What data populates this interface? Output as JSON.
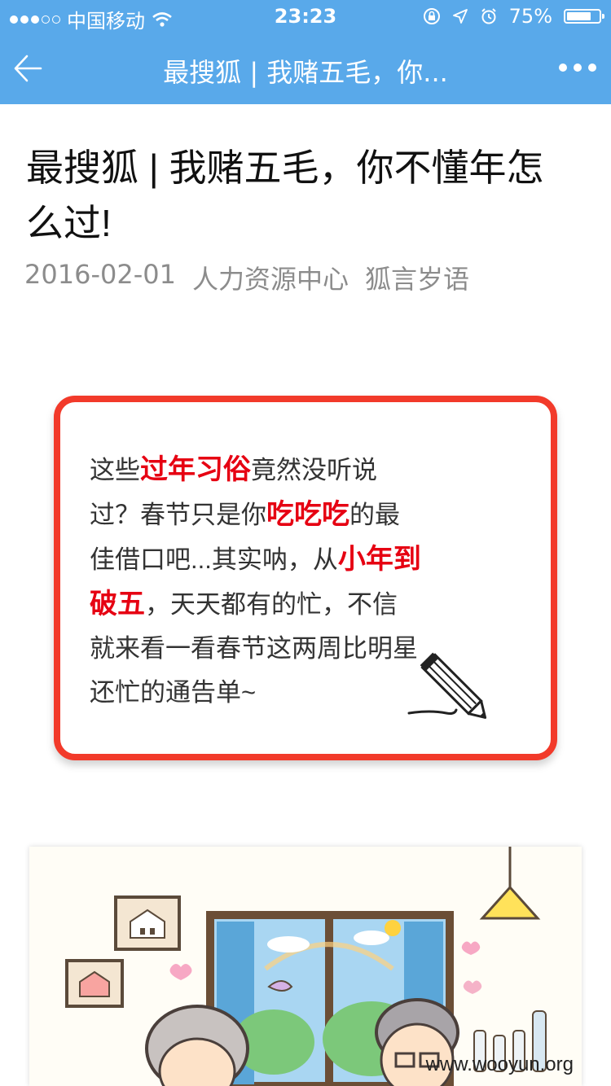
{
  "status_bar": {
    "carrier": "中国移动",
    "time": "23:23",
    "battery_pct": "75%",
    "battery_level": 0.75,
    "signal_bars_filled": 3,
    "signal_bars_total": 5
  },
  "nav": {
    "title": "最搜狐 | 我赌五毛，你..."
  },
  "article": {
    "title": "最搜狐 | 我赌五毛，你不懂年怎么过!",
    "date": "2016-02-01",
    "author": "人力资源中心",
    "account": "狐言岁语"
  },
  "intro": {
    "t1": "这些",
    "h1": "过年习俗",
    "t2": "竟然没听说过？春节只是你",
    "h2": "吃吃吃",
    "t3": "的最佳借口吧...其实呐，从",
    "h3": "小年到破五",
    "t4": "，天天都有的忙，不信就来看一看春节这两周比明星还忙的通告单~"
  },
  "watermark": "www.wooyun.org",
  "colors": {
    "header_blue": "#59a9ea",
    "highlight_red": "#e60012",
    "card_border": "#f23a2a"
  },
  "icons": [
    "back-arrow-icon",
    "more-icon",
    "wifi-icon",
    "lock-rotation-icon",
    "location-icon",
    "alarm-icon",
    "battery-icon",
    "pencil-icon"
  ]
}
